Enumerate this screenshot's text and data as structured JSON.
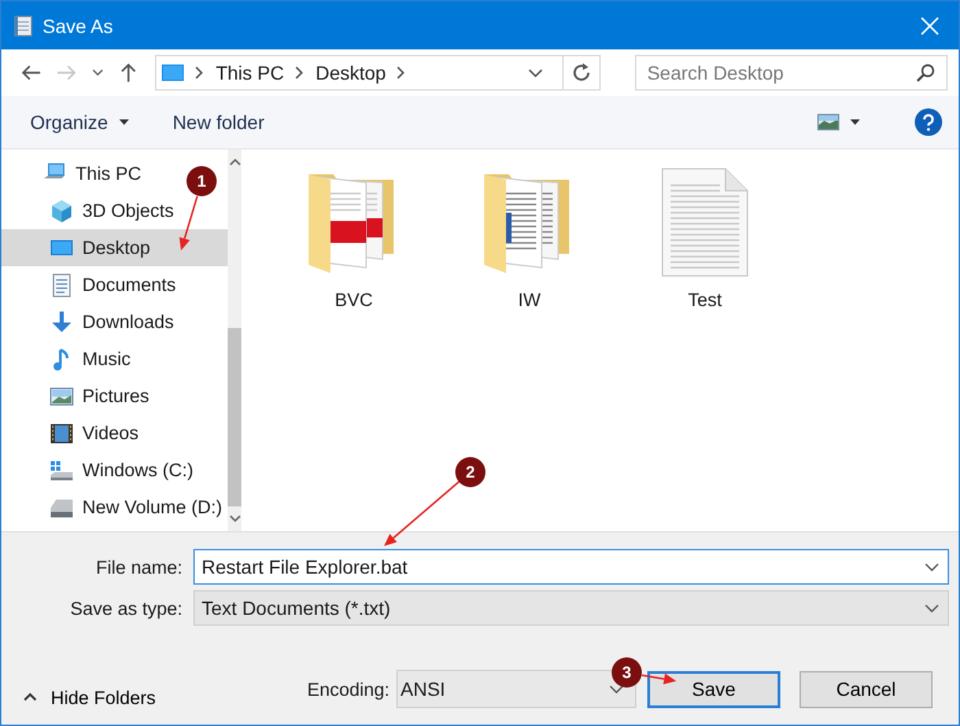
{
  "window": {
    "title": "Save As"
  },
  "nav": {
    "path": [
      "This PC",
      "Desktop"
    ],
    "search": {
      "placeholder": "Search Desktop"
    }
  },
  "toolbar": {
    "buttons": [
      {
        "label": "Organize",
        "dropdown": true
      },
      {
        "label": "New folder",
        "dropdown": false
      }
    ]
  },
  "sidebar": {
    "items": [
      {
        "label": "This PC",
        "kind": "pc",
        "selected": false,
        "children": [
          {
            "label": "3D Objects",
            "kind": "cube",
            "selected": false
          },
          {
            "label": "Desktop",
            "kind": "desktop",
            "selected": true
          },
          {
            "label": "Documents",
            "kind": "documents",
            "selected": false
          },
          {
            "label": "Downloads",
            "kind": "download",
            "selected": false
          },
          {
            "label": "Music",
            "kind": "music",
            "selected": false
          },
          {
            "label": "Pictures",
            "kind": "pictures",
            "selected": false
          },
          {
            "label": "Videos",
            "kind": "videos",
            "selected": false
          },
          {
            "label": "Windows (C:)",
            "kind": "system-drive",
            "selected": false
          },
          {
            "label": "New Volume (D:)",
            "kind": "drive",
            "selected": false
          }
        ]
      }
    ]
  },
  "files": [
    {
      "name": "BVC",
      "kind": "folder-pdf"
    },
    {
      "name": "IW",
      "kind": "folder-doc"
    },
    {
      "name": "Test",
      "kind": "text"
    }
  ],
  "form": {
    "file_name": {
      "label": "File name:",
      "value": "Restart File Explorer.bat"
    },
    "save_as_type": {
      "label": "Save as type:",
      "value": "Text Documents (*.txt)"
    }
  },
  "footer": {
    "hide_folders": "Hide Folders",
    "encoding": {
      "label": "Encoding:",
      "value": "ANSI"
    },
    "buttons": [
      {
        "label": "Save",
        "default": true
      },
      {
        "label": "Cancel",
        "default": false
      }
    ]
  },
  "annotations": [
    {
      "number": "1"
    },
    {
      "number": "2"
    },
    {
      "number": "3"
    }
  ]
}
